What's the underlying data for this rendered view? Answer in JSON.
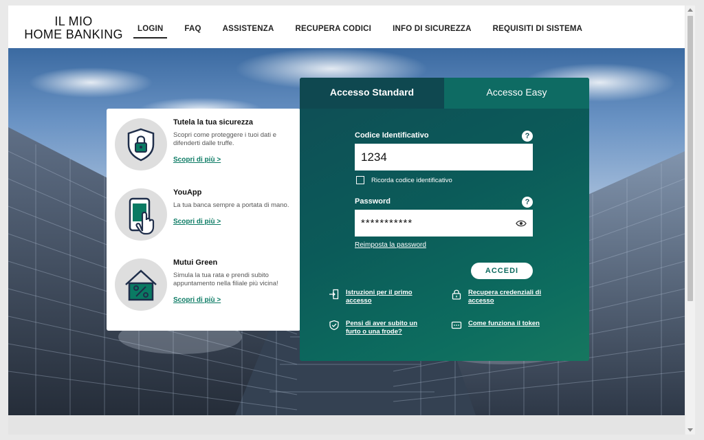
{
  "header": {
    "logo_line1": "IL MIO",
    "logo_line2": "HOME BANKING",
    "nav": [
      "LOGIN",
      "FAQ",
      "ASSISTENZA",
      "RECUPERA CODICI",
      "INFO DI SICUREZZA",
      "REQUISITI DI SISTEMA"
    ]
  },
  "info": [
    {
      "title": "Tutela la tua sicurezza",
      "text": "Scopri come proteggere i tuoi dati e difenderti dalle truffe.",
      "link": "Scopri di più >",
      "icon": "shield-lock-icon"
    },
    {
      "title": "YouApp",
      "text": "La tua banca sempre a portata di mano.",
      "link": "Scopri di più >",
      "icon": "smartphone-tap-icon"
    },
    {
      "title": "Mutui Green",
      "text": "Simula la tua rata e prendi subito appuntamento nella filiale più vicina!",
      "link": "Scopri di più >",
      "icon": "house-percent-icon"
    }
  ],
  "login": {
    "tab_standard": "Accesso Standard",
    "tab_easy": "Accesso Easy",
    "code_label": "Codice Identificativo",
    "code_value": "1234",
    "remember_label": "Ricorda codice identificativo",
    "password_label": "Password",
    "password_value": "***********",
    "help_glyph": "?",
    "reset_link": "Reimposta la password",
    "submit_label": "ACCEDI",
    "links": {
      "first_access": "Istruzioni per il primo accesso",
      "recover": "Recupera credenziali di accesso",
      "fraud": "Pensi di aver subito un furto o una frode?",
      "token": "Come funziona il token"
    }
  },
  "colors": {
    "accent_green": "#0a7a63",
    "panel_dark": "#0f4850",
    "panel_tab_easy": "#0e6b63"
  }
}
